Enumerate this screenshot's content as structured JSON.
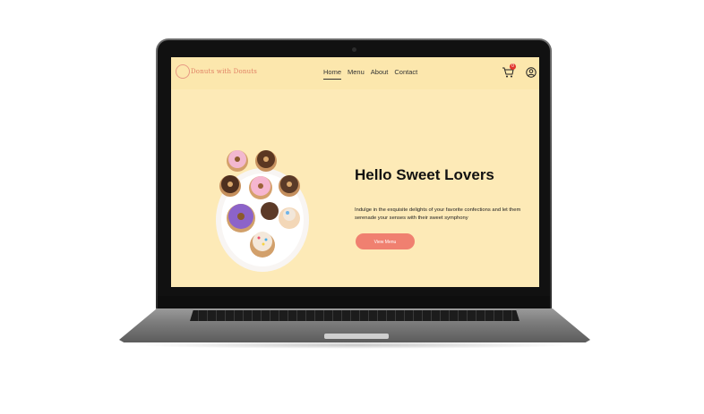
{
  "site": {
    "logo_text": "Donuts with Donuts",
    "nav": [
      "Home",
      "Menu",
      "About",
      "Contact"
    ],
    "cart_count": "0",
    "hero": {
      "title": "Hello Sweet Lovers",
      "text": "Indulge in the exquisite delights of your favorite confections and let them serenade your senses with their sweet symphony",
      "button": "View Menu"
    }
  },
  "colors": {
    "screen_bg": "#fdeab7",
    "accent": "#f08070",
    "badge": "#e2352c"
  },
  "icons": [
    "logo-icon",
    "cart-icon",
    "user-icon"
  ]
}
